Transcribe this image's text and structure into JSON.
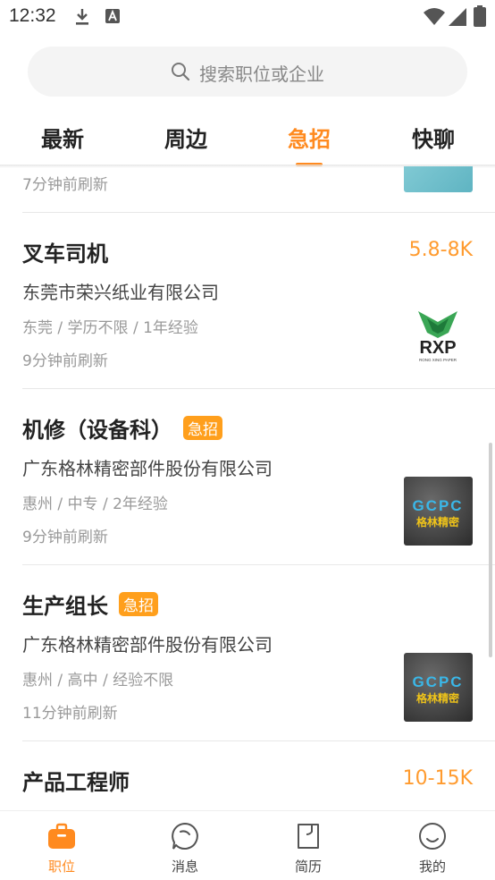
{
  "status_bar": {
    "time": "12:32"
  },
  "search": {
    "placeholder": "搜索职位或企业"
  },
  "tabs": [
    {
      "label": "最新",
      "active": false
    },
    {
      "label": "周边",
      "active": false
    },
    {
      "label": "急招",
      "active": true
    },
    {
      "label": "快聊",
      "active": false
    }
  ],
  "jobs": [
    {
      "refresh": "7分钟前刷新"
    },
    {
      "title": "叉车司机",
      "salary": "5.8-8K",
      "company": "东莞市荣兴纸业有限公司",
      "meta": "东莞 / 学历不限 / 1年经验",
      "refresh": "9分钟前刷新",
      "logo_text": "RXP",
      "logo_subtext": "RONG XING PAPER"
    },
    {
      "title": "机修（设备科）",
      "urgent": "急招",
      "company": "广东格林精密部件股份有限公司",
      "meta": "惠州 / 中专 / 2年经验",
      "refresh": "9分钟前刷新",
      "logo_text": "GCPC",
      "logo_subtext": "格林精密"
    },
    {
      "title": "生产组长",
      "urgent": "急招",
      "company": "广东格林精密部件股份有限公司",
      "meta": "惠州 / 高中 / 经验不限",
      "refresh": "11分钟前刷新",
      "logo_text": "GCPC",
      "logo_subtext": "格林精密"
    },
    {
      "title": "产品工程师",
      "salary": "10-15K"
    }
  ],
  "bottom_nav": [
    {
      "label": "职位",
      "icon": "briefcase-icon",
      "active": true
    },
    {
      "label": "消息",
      "icon": "chat-bubble-icon",
      "active": false
    },
    {
      "label": "简历",
      "icon": "document-icon",
      "active": false
    },
    {
      "label": "我的",
      "icon": "smiley-icon",
      "active": false
    }
  ],
  "colors": {
    "accent": "#ff8a1f",
    "salary": "#ff9b2f",
    "badge": "#ff9f1c"
  }
}
